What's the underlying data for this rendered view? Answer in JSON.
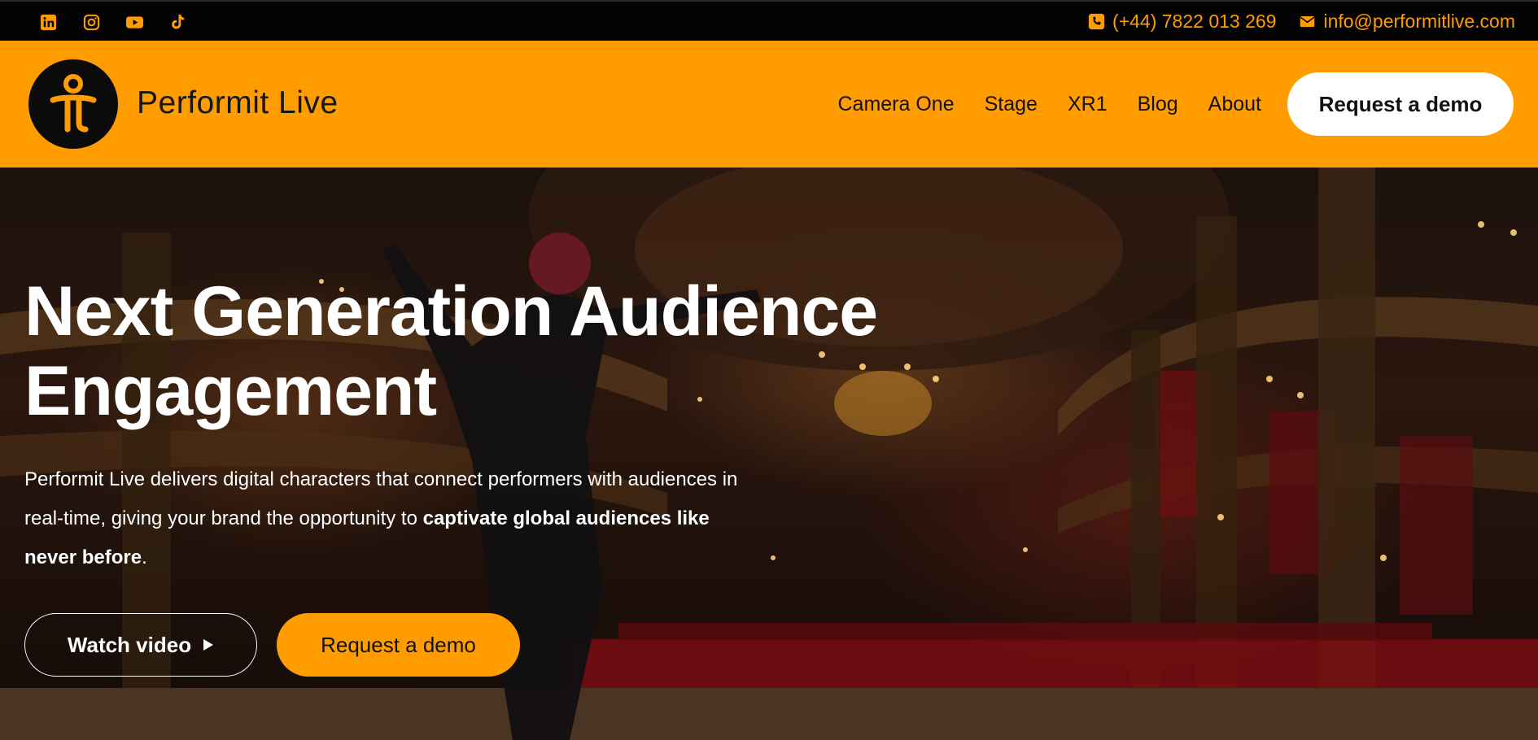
{
  "colors": {
    "accent": "#ff9c00",
    "topbar": "#020202",
    "cta_bg": "#ffffff"
  },
  "topbar": {
    "social_icons": [
      "linkedin-icon",
      "instagram-icon",
      "youtube-icon",
      "tiktok-icon"
    ],
    "phone": "(+44) 7822 013 269",
    "email": "info@performitlive.com"
  },
  "header": {
    "brand": "Performit Live",
    "nav": [
      "Camera One",
      "Stage",
      "XR1",
      "Blog",
      "About"
    ],
    "cta": "Request a demo"
  },
  "hero": {
    "title_line1": "Next Generation Audience",
    "title_line2": "Engagement",
    "text_plain_1": "Performit Live delivers digital characters that connect performers with audiences in real-time, giving your brand the opportunity to ",
    "text_bold": "captivate global audiences like never before",
    "text_plain_2": ".",
    "watch_label": "Watch video",
    "demo_label": "Request a demo"
  }
}
